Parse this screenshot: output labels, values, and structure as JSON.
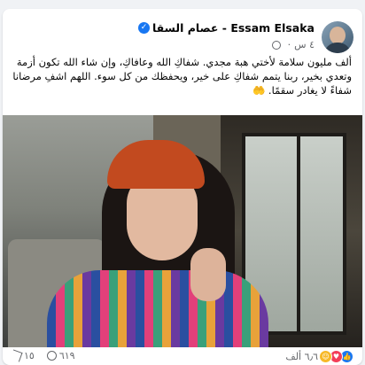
{
  "post": {
    "author_names": "Essam Elsaka - عصام السقا",
    "timestamp": "٤ س",
    "separator": "·",
    "text": "ألف مليون سلامة لأختي هبة مجدي. شفاكِ الله وعافاكِ، وإن شاء الله تكون أزمة وتعدي بخير، ربنا يتمم شفاكِ على خير، ويحفظك من كل سوء. اللهم اشفِ مرضانا شفاءً لا يغادر سقمًا. 🤲"
  },
  "footer": {
    "reactions_count": "٦٫٦ ألف",
    "comments_count": "٦١٩",
    "shares_count": "١٥"
  },
  "icons": {
    "verified": "verified-badge-icon",
    "audience": "globe-icon",
    "reactions": [
      "like-icon",
      "love-icon",
      "care-icon"
    ],
    "comment": "comment-icon",
    "share": "share-icon"
  },
  "colors": {
    "accent": "#1877f2",
    "love": "#f33e58",
    "care": "#f7b928",
    "secondary_text": "#65676b"
  }
}
